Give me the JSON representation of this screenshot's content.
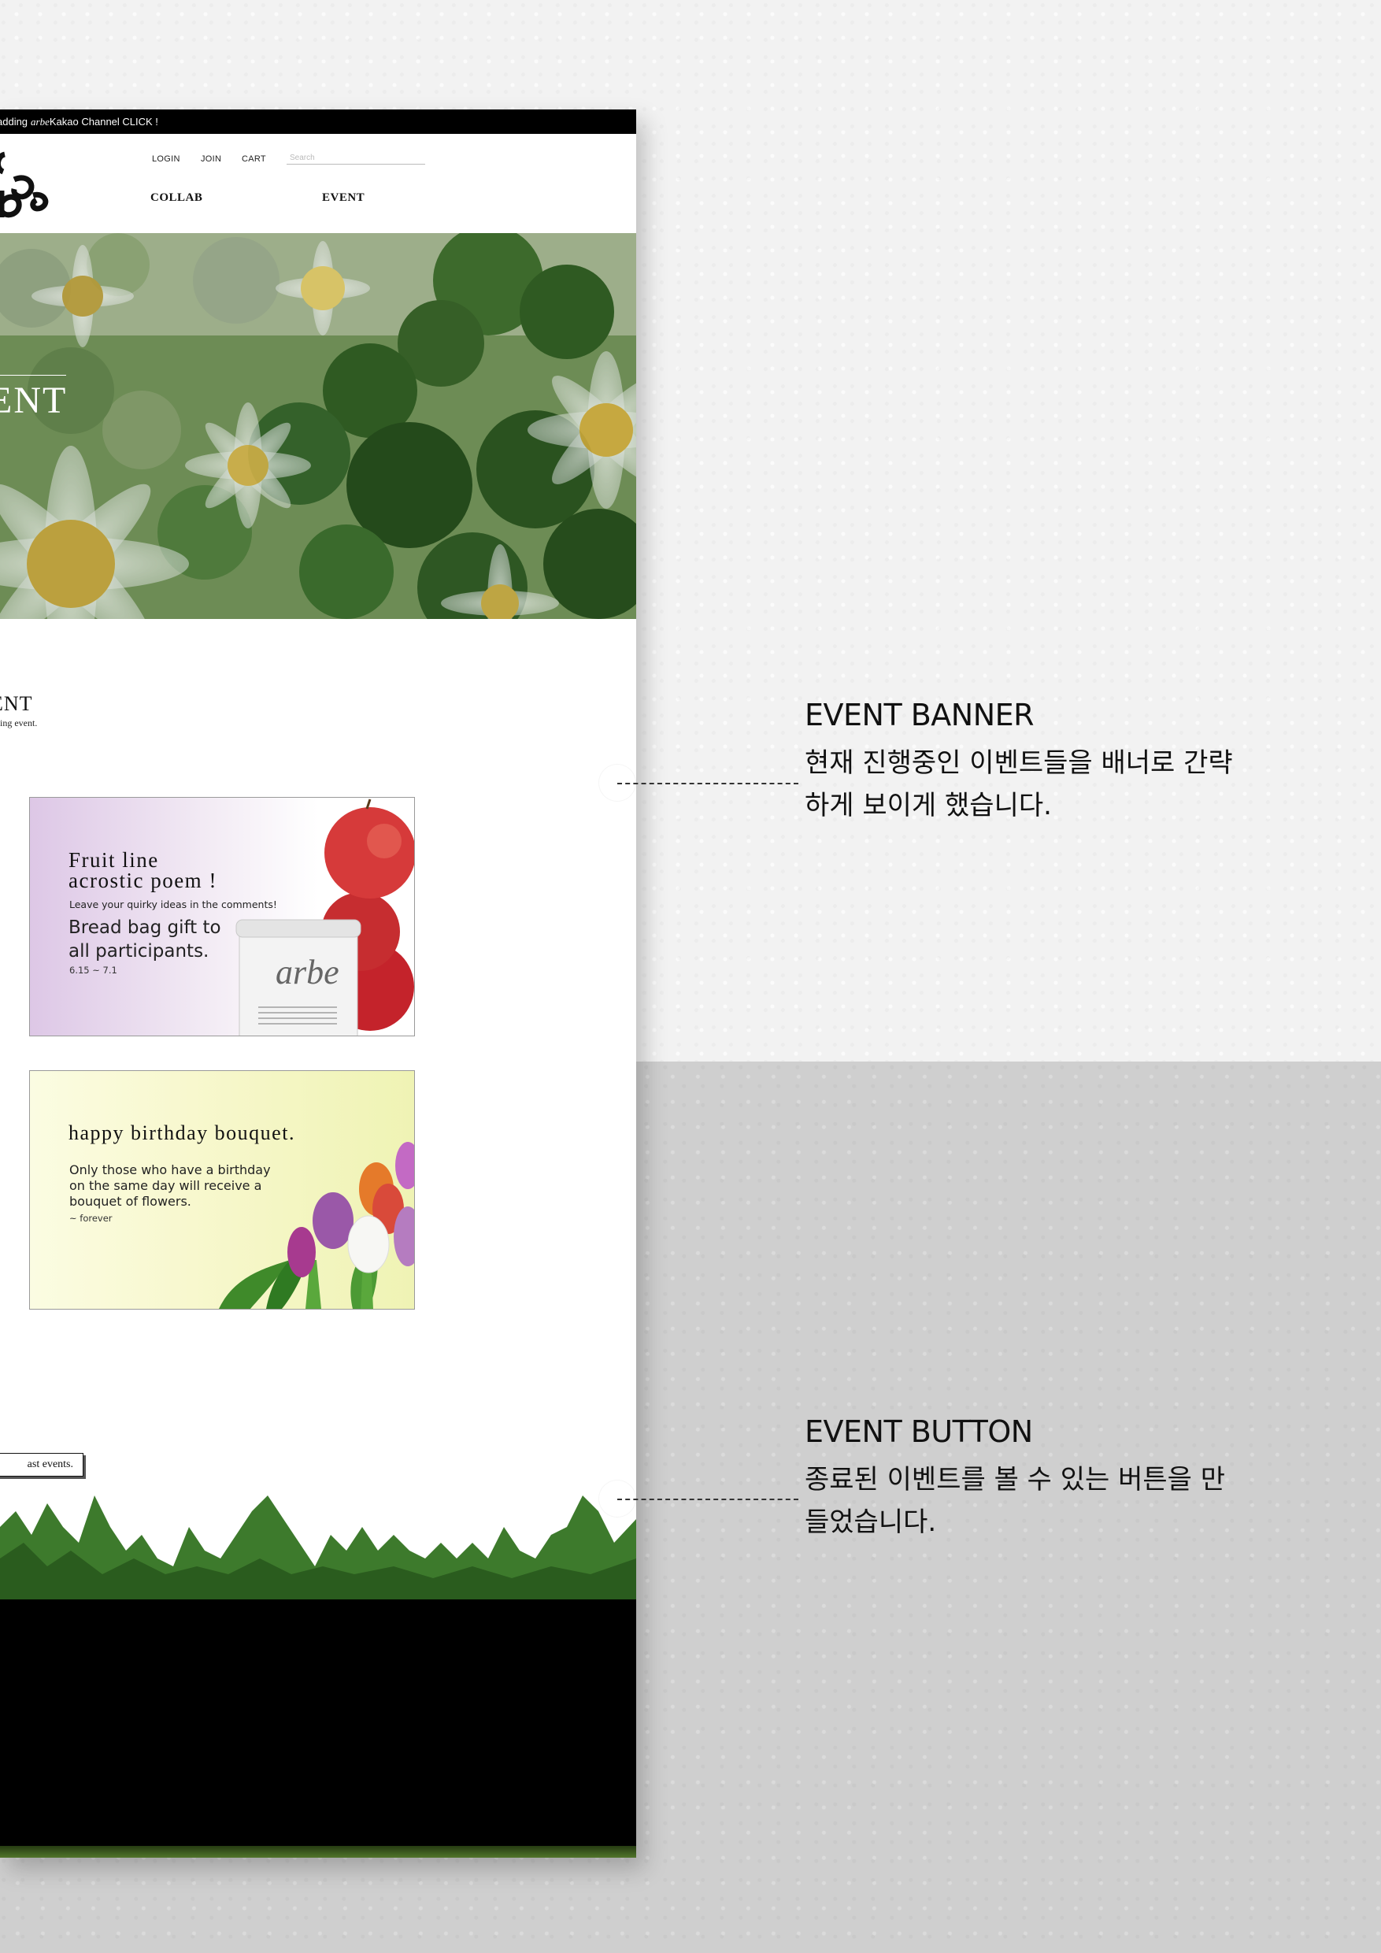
{
  "notice_bar": {
    "pre": "adding",
    "brand": "arbe",
    "post": "Kakao Channel CLICK !"
  },
  "header": {
    "logo_alt": "arbe",
    "util_links": [
      "LOGIN",
      "JOIN",
      "CART"
    ],
    "search_placeholder": "Search",
    "nav": [
      "COLLAB",
      "EVENT"
    ]
  },
  "hero": {
    "title": "ENT"
  },
  "event_section": {
    "title": "ENT",
    "subtitle": "oing event."
  },
  "banners": [
    {
      "title_line1": "Fruit  line",
      "title_line2": "acrostic poem !",
      "small": "Leave your quirky ideas in the comments!",
      "big_line1": "Bread bag gift to",
      "big_line2": "all participants.",
      "date": "6.15 ~ 7.1",
      "bag_logo": "arbe"
    },
    {
      "title": "happy birthday bouquet.",
      "body_line1": "Only those who have a birthday",
      "body_line2": "on the same day will receive a",
      "body_line3": "bouquet of flowers.",
      "date": "~ forever"
    }
  ],
  "past_button": {
    "label": "ast events."
  },
  "annotations": [
    {
      "title": "EVENT BANNER",
      "desc_line1": "현재 진행중인 이벤트들을 배너로 간략",
      "desc_line2": "하게 보이게 했습니다."
    },
    {
      "title": "EVENT BUTTON",
      "desc_line1": "종료된 이벤트를 볼 수 있는 버튼을 만",
      "desc_line2": "들었습니다."
    }
  ],
  "colors": {
    "notice_bar": "#000000",
    "footer": "#000000",
    "bg_top": "#f2f2f2",
    "bg_bottom": "#cfcfcf"
  }
}
